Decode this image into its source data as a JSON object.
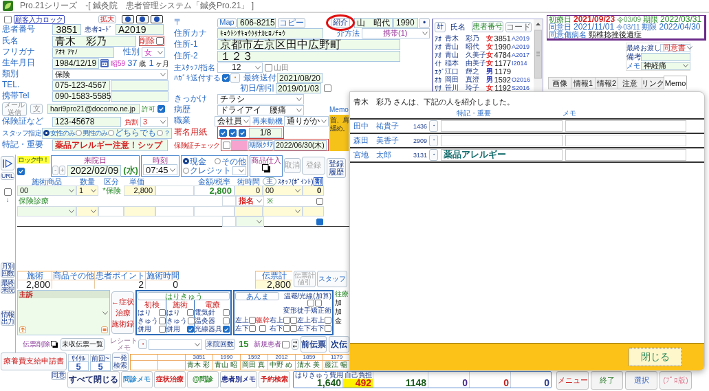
{
  "window": {
    "title": "Pro.21シリーズ　-[ 鍼灸院　患者管理システム「鍼灸Pro.21」 ]"
  },
  "patient": {
    "lines": [
      {
        "items": [
          {
            "kind": "check",
            "checked": false
          },
          {
            "kind": "tag",
            "text": "顧客入力ロック"
          },
          {
            "kind": "button",
            "text": "拡大"
          },
          {
            "kind": "dot_button"
          },
          {
            "kind": "dot_button"
          },
          {
            "kind": "dot_button"
          }
        ]
      },
      {
        "items": [
          {
            "kind": "label",
            "text": "患者番号"
          },
          {
            "kind": "field",
            "value": "3851"
          },
          {
            "kind": "label",
            "text": "患者ｺｰﾄﾞ"
          },
          {
            "kind": "field",
            "value": "A2019"
          }
        ]
      },
      {
        "items": [
          {
            "kind": "label",
            "text": "氏名"
          },
          {
            "kind": "field",
            "value": "青木　彩乃"
          },
          {
            "kind": "check",
            "label": "削除",
            "checked": false
          }
        ]
      },
      {
        "items": [
          {
            "kind": "label",
            "text": "フリガナ"
          },
          {
            "kind": "field",
            "value": "ｱｵｷ ｱﾔﾉ"
          },
          {
            "kind": "label",
            "text": "性別"
          },
          {
            "kind": "select",
            "value": "女"
          }
        ]
      },
      {
        "items": [
          {
            "kind": "label",
            "text": "生年月日"
          },
          {
            "kind": "field",
            "value": "1984/12/19"
          },
          {
            "kind": "calendar_button"
          },
          {
            "kind": "text",
            "text": "昭59"
          },
          {
            "kind": "text",
            "text": "37"
          },
          {
            "kind": "text",
            "text": "歳"
          },
          {
            "kind": "text",
            "text": "1"
          },
          {
            "kind": "text",
            "text": "ヶ月"
          }
        ]
      },
      {
        "items": [
          {
            "kind": "label",
            "text": "類別"
          },
          {
            "kind": "select",
            "value": "保険"
          }
        ]
      },
      {
        "items": [
          {
            "kind": "label",
            "text": "TEL."
          },
          {
            "kind": "field",
            "value": "075-123-4567"
          },
          {
            "kind": "field"
          }
        ]
      },
      {
        "items": [
          {
            "kind": "label",
            "text": "携帯Tel"
          },
          {
            "kind": "field",
            "value": "090-1583-5585"
          },
          {
            "kind": "field"
          }
        ]
      },
      {
        "items": [
          {
            "kind": "button",
            "text": "メール送信"
          },
          {
            "kind": "button",
            "text": "文"
          },
          {
            "kind": "field",
            "value": "hari9pro21@docomo.ne.jp"
          },
          {
            "kind": "label",
            "text": "許可"
          },
          {
            "kind": "check",
            "checked": true
          }
        ]
      },
      {
        "items": [
          {
            "kind": "label",
            "text": "保険証など"
          },
          {
            "kind": "field",
            "value": "123-45678"
          },
          {
            "kind": "label",
            "text": "負割"
          },
          {
            "kind": "select",
            "value": "3"
          }
        ]
      },
      {
        "items": [
          {
            "kind": "label",
            "text": "スタッフ指定"
          },
          {
            "kind": "radio",
            "text": "女性のみ",
            "selected": true
          },
          {
            "kind": "radio",
            "text": "男性のみ",
            "selected": false
          },
          {
            "kind": "radio",
            "text": "どちらでも",
            "selected": false
          },
          {
            "kind": "radio",
            "text": "？",
            "selected": false
          }
        ]
      },
      {
        "items": [
          {
            "kind": "label",
            "text": "特記・重要"
          },
          {
            "kind": "field",
            "value": "薬品アレルギー注意！シップ"
          }
        ]
      }
    ]
  },
  "address": {
    "lines": [
      {
        "items": [
          {
            "kind": "label",
            "text": "〒"
          },
          {
            "kind": "button",
            "text": "Map"
          },
          {
            "kind": "field",
            "value": "606-8215"
          },
          {
            "kind": "button",
            "text": "コピー"
          },
          {
            "kind": "button",
            "text": "紹介",
            "highlighted": true
          },
          {
            "kind": "field",
            "value": "山　昭代"
          },
          {
            "kind": "field",
            "value": "1990"
          },
          {
            "kind": "button",
            "text": "•"
          }
        ]
      },
      {
        "items": [
          {
            "kind": "label",
            "text": "住所カナ"
          },
          {
            "kind": "field",
            "value": "ｷｮｳﾄｼｻｷｮｳｸﾀﾅｶﾋﾛﾉﾁｮｳ"
          },
          {
            "kind": "label",
            "text": "介方法"
          },
          {
            "kind": "select",
            "value": "携帯(1)"
          }
        ]
      },
      {
        "items": [
          {
            "kind": "label",
            "text": "住所-1"
          },
          {
            "kind": "field",
            "value": "京都市左京区田中広野町"
          }
        ]
      },
      {
        "items": [
          {
            "kind": "label",
            "text": "住所-2"
          },
          {
            "kind": "field",
            "value": "１２３"
          }
        ]
      },
      {
        "items": [
          {
            "kind": "label",
            "text": "主ｽﾀｯﾌ/指名"
          },
          {
            "kind": "select",
            "value": "12"
          },
          {
            "kind": "check",
            "label": "山田",
            "checked": false
          }
        ]
      },
      {
        "items": [
          {
            "kind": "label",
            "text": "ﾊｶﾞｷ送付する"
          },
          {
            "kind": "check",
            "checked": true
          },
          {
            "kind": "button",
            "text": "・"
          },
          {
            "kind": "label",
            "text": "最終送付"
          },
          {
            "kind": "field",
            "value": "2021/08/20"
          }
        ]
      },
      {
        "items": [
          {
            "kind": "label",
            "text": "初日/割引"
          },
          {
            "kind": "field",
            "value": "2019/01/03"
          },
          {
            "kind": "check",
            "checked": false
          }
        ]
      },
      {
        "items": [
          {
            "kind": "label",
            "text": "きっかけ"
          },
          {
            "kind": "select",
            "value": "チラシ"
          }
        ]
      },
      {
        "items": [
          {
            "kind": "label",
            "text": "病歴"
          },
          {
            "kind": "select",
            "value": "ドライアイ　腰痛"
          }
        ]
      },
      {
        "items": [
          {
            "kind": "label",
            "text": "職業"
          },
          {
            "kind": "select",
            "value": "会社員"
          },
          {
            "kind": "label",
            "text": "再来動機"
          },
          {
            "kind": "select",
            "value": "通りがか"
          }
        ]
      },
      {
        "items": [
          {
            "kind": "label",
            "text": "署名用紙"
          },
          {
            "kind": "check",
            "checked": true
          },
          {
            "kind": "check",
            "checked": true
          },
          {
            "kind": "check",
            "checked": true
          },
          {
            "kind": "field",
            "value": "1/8"
          }
        ]
      },
      {
        "items": [
          {
            "kind": "label",
            "text": "保険証チェック"
          },
          {
            "kind": "check",
            "checked": false
          },
          {
            "kind": "field"
          },
          {
            "kind": "button",
            "text": "期限ｸﾘｱ"
          },
          {
            "kind": "field",
            "value": "2022/06/30(木)"
          }
        ]
      }
    ],
    "memo": {
      "label": "Memo",
      "lines": [
        "首、肩",
        "緩め。"
      ]
    }
  },
  "patient_list": {
    "header": [
      {
        "kind": "button",
        "text": "ｶﾅ"
      },
      {
        "kind": "label",
        "text": "氏名"
      },
      {
        "kind": "button",
        "text": "患者番号"
      },
      {
        "kind": "button",
        "text": "コード"
      }
    ],
    "rows": [
      {
        "kind": "female",
        "kana": "ｱｵ",
        "name": "青木　彩乃",
        "sex": "女",
        "number": "3851",
        "code": "A2019"
      },
      {
        "kind": "female",
        "kana": "ｱｵ",
        "name": "青山　昭代",
        "sex": "女",
        "number": "1990",
        "code": "A2019"
      },
      {
        "kind": "female",
        "kana": "ｱｵ",
        "name": "青山　久美子",
        "sex": "女",
        "number": "4784",
        "code": "A2017"
      },
      {
        "kind": "female",
        "kana": "ｲﾅ",
        "name": "稲本　由美子",
        "sex": "女",
        "number": "1177",
        "code": "I2014"
      },
      {
        "kind": "male",
        "kana": "ｴｸﾞ",
        "name": "江口　輝之",
        "sex": "男",
        "number": "1179"
      },
      {
        "kind": "male",
        "kana": "ｵｶ",
        "name": "岡田　真澄",
        "sex": "男",
        "number": "1592",
        "code": "O2016"
      },
      {
        "kind": "female",
        "kana": "ｻｻ",
        "name": "笹川　玲子",
        "sex": "女",
        "number": "1192",
        "code": "S2016"
      }
    ]
  },
  "info_panel": {
    "consent": [
      {
        "label": "初療日",
        "date": "2021/09/23",
        "era": "令03/09",
        "limit_label": "期限",
        "limit": "2022/03/31"
      },
      {
        "label": "同意日",
        "date": "2021/11/01",
        "era": "令03/11",
        "limit_label": "期限",
        "limit": "2022/04/30"
      }
    ],
    "disease_label": "同意傷病名",
    "disease": "頸椎捻挫後遺症",
    "handover": {
      "label": "最終お渡し",
      "value": "同意書"
    },
    "remarks": {
      "label": "備考"
    },
    "memo": {
      "label": "メモ",
      "value": "神経痛"
    },
    "tabs": [
      {
        "label": "画像",
        "selected": false
      },
      {
        "label": "情報1",
        "selected": false
      },
      {
        "label": "情報2",
        "selected": false
      },
      {
        "label": "注意",
        "selected": false
      },
      {
        "label": "リンク",
        "selected": false
      },
      {
        "label": "Memo",
        "selected": true
      }
    ]
  },
  "side_tools": [
    {
      "kind": "play_button"
    },
    {
      "kind": "button",
      "text": "URL"
    },
    {
      "kind": "check",
      "checked": false
    },
    {
      "kind": "text",
      "text": "↓"
    },
    {
      "kind": "button",
      "text": "月別回数"
    },
    {
      "kind": "button",
      "text": "最終来院"
    },
    {
      "kind": "button",
      "text": "情報出力"
    }
  ],
  "visit": {
    "lock": {
      "badge": "ロック中！",
      "checked": true
    },
    "date": {
      "label": "来院日",
      "minus": "-",
      "plus": "+",
      "value": "2022/02/09",
      "weekday": "(水)"
    },
    "time": {
      "label": "時刻",
      "value": "07:45"
    },
    "payment": [
      {
        "label": "現金",
        "selected": true
      },
      {
        "label": "その他",
        "selected": false
      },
      {
        "label": "クレジット",
        "selected": false
      }
    ],
    "purchase": {
      "label": "商品仕入"
    },
    "actions": [
      {
        "text": "取消",
        "disabled": true
      },
      {
        "text": "登録",
        "disabled": true
      },
      {
        "text": "登録履歴",
        "disabled": false
      }
    ]
  },
  "items_table": {
    "columns": [
      "施術商品",
      "数量",
      "区分",
      "単価",
      "金額/税率",
      "術時間",
      "主",
      "ｽﾀｯﾌ(ﾎﾟｲﾝﾄ)",
      "割"
    ],
    "rows": [
      {
        "kind": "entry",
        "product": "00",
        "quantity": "1",
        "category": "*保険",
        "unit_price": "2,800",
        "amount": "2,800",
        "duration": "0",
        "staff": "00",
        "discount": "0",
        "note": "保険診療",
        "nomination": "指名",
        "mark": "※",
        "checked": false
      },
      {
        "kind": "empty",
        "checked": true
      }
    ]
  },
  "totals": {
    "cells": [
      {
        "label": "施術",
        "value": "2,800"
      },
      {
        "label": "商品その他"
      },
      {
        "label": "患者ポイント",
        "value": "2"
      },
      {
        "label": "施術時間",
        "value": "0"
      }
    ],
    "slip_total": {
      "label": "伝票計",
      "value": "2,800"
    },
    "buttons": [
      {
        "text": "伝票計値引",
        "disabled": true
      },
      {
        "text": "スタッフ",
        "disabled": false
      }
    ]
  },
  "treatment": {
    "complaint_label": "主訴",
    "symptom_button": [
      "←症状",
      "治療",
      "施術録"
    ],
    "acupuncture": {
      "title": "はりきゅう",
      "groups": [
        {
          "title": "初検",
          "items": [
            {
              "label": "はり",
              "checked": false
            },
            {
              "label": "きゅう",
              "checked": false
            },
            {
              "label": "併用",
              "checked": false
            }
          ]
        },
        {
          "title": "施術",
          "items": [
            {
              "label": "はり",
              "checked": false
            },
            {
              "label": "きゅう",
              "checked": false
            },
            {
              "label": "併用",
              "checked": true
            }
          ]
        },
        {
          "title": "電療",
          "items": [
            {
              "label": "電気針",
              "checked": false
            },
            {
              "label": "温灸器",
              "checked": false
            },
            {
              "label": "光線器具",
              "checked": true
            }
          ]
        }
      ]
    },
    "massage": {
      "title": "あんま",
      "heat_label": "温罨/光線(加算)",
      "heat": [
        {
          "checked": false
        },
        {
          "checked": false
        }
      ],
      "correction_label": "変形徒手矯正術",
      "lines": [
        {
          "items": [
            {
              "kind": "label",
              "text": "左上"
            },
            {
              "kind": "check",
              "checked": false
            },
            {
              "kind": "label",
              "text": "躯幹"
            },
            {
              "kind": "label",
              "text": "右上"
            },
            {
              "kind": "check",
              "checked": false
            },
            {
              "kind": "check",
              "checked": false
            },
            {
              "kind": "label",
              "text": "左上"
            },
            {
              "kind": "label",
              "text": "右上"
            },
            {
              "kind": "check",
              "checked": false
            }
          ]
        },
        {
          "items": [
            {
              "kind": "label",
              "text": "左下"
            },
            {
              "kind": "check",
              "checked": false
            },
            {
              "kind": "check",
              "checked": false
            },
            {
              "kind": "label",
              "text": "右下"
            },
            {
              "kind": "check",
              "checked": false
            },
            {
              "kind": "check",
              "checked": false
            },
            {
              "kind": "label",
              "text": "左下"
            },
            {
              "kind": "label",
              "text": "右下"
            },
            {
              "kind": "check",
              "checked": false
            }
          ]
        }
      ]
    },
    "house_call": [
      "往療",
      "加",
      "加",
      "金"
    ]
  },
  "slip_bar": {
    "delete_label": "伝票削除",
    "unpaid_button": "未収伝票一覧",
    "receipt_label": "レシートメモ",
    "receipt_button": "・",
    "visits_button": "来院回数",
    "visits": "15",
    "new_label": "新規患者",
    "new_checked": false,
    "prev_button": "前伝票",
    "next_button": "次伝"
  },
  "bottom": {
    "claim_button": "療養費支給申請書",
    "consent_button": "同意",
    "cycle": [
      {
        "label": "ｻｲｸﾙ",
        "value": "5"
      },
      {
        "label": "前回~",
        "value": "5"
      }
    ],
    "quick_search": "一発検索",
    "recent": [
      {
        "number": "3851",
        "name": "青木 彩"
      },
      {
        "number": "1990",
        "name": "青山 昭"
      },
      {
        "number": "1592",
        "name": "岡田 真"
      },
      {
        "number": "2012",
        "name": "中野 め"
      },
      {
        "number": "1859",
        "name": "清水 美"
      },
      {
        "number": "1179",
        "name": "藤江 暢"
      }
    ],
    "shortcuts": [
      "すべて閉じる",
      "問診メモ",
      "症状治療",
      "@問診",
      "患者別メモ",
      "予約検索"
    ],
    "fees": [
      {
        "label": "はりきゅう費用",
        "value": "1,640"
      },
      {
        "label": "自己負担",
        "value": "492",
        "highlighted": true
      },
      {
        "value": "1148"
      },
      {
        "value": "0"
      },
      {
        "value": "0"
      },
      {
        "value": "0"
      }
    ],
    "menu": [
      "メニュー",
      "終了",
      "選択",
      "(ﾌﾟﾛ版)"
    ]
  },
  "referral_dialog": {
    "message": "青木　彩乃 さんは、下記の人を紹介しました。",
    "columns": [
      "特記・重要",
      "メモ"
    ],
    "rows": [
      {
        "name": "田中　祐貴子",
        "number": "1436",
        "button": "・"
      },
      {
        "name": "森田　美香子",
        "number": "2909",
        "button": "・"
      },
      {
        "name": "宮地　太郎",
        "number": "3131",
        "button": "・",
        "note": "薬品アレルギー"
      }
    ],
    "close_button": "閉じる"
  }
}
